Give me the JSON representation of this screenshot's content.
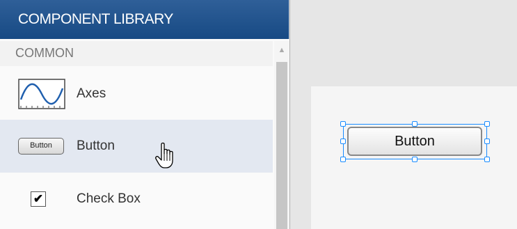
{
  "library": {
    "title": "COMPONENT LIBRARY",
    "category": "COMMON",
    "items": [
      {
        "label": "Axes",
        "icon": "axes-icon"
      },
      {
        "label": "Button",
        "icon": "button-icon",
        "icon_text": "Button",
        "hovered": true
      },
      {
        "label": "Check Box",
        "icon": "checkbox-icon"
      }
    ]
  },
  "canvas": {
    "button_label": "Button"
  },
  "colors": {
    "header": "#1f4f88",
    "hover_row": "#e3e8f1",
    "selection": "#1a8cff"
  }
}
